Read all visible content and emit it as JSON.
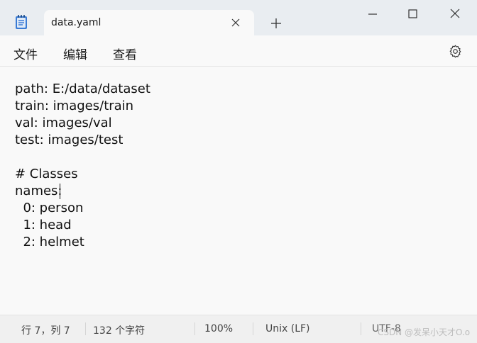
{
  "titlebar": {
    "tab_title": "data.yaml",
    "app_icon": "notepad-icon",
    "close_tab_icon": "close-icon",
    "new_tab_icon": "plus-icon",
    "minimize_icon": "minimize-icon",
    "maximize_icon": "maximize-icon",
    "close_window_icon": "close-icon"
  },
  "menubar": {
    "file": "文件",
    "edit": "编辑",
    "view": "查看",
    "settings_icon": "gear-icon"
  },
  "editor": {
    "lines": [
      "path: E:/data/dataset",
      "train: images/train",
      "val: images/val",
      "test: images/test",
      "",
      "# Classes",
      "names:",
      "  0: person",
      "  1: head",
      "  2: helmet"
    ]
  },
  "statusbar": {
    "position": "行 7，列 7",
    "char_count": "132 个字符",
    "zoom": "100%",
    "line_ending": "Unix (LF)",
    "encoding": "UTF-8",
    "watermark": "CSDN @发呆小天才O.o"
  }
}
